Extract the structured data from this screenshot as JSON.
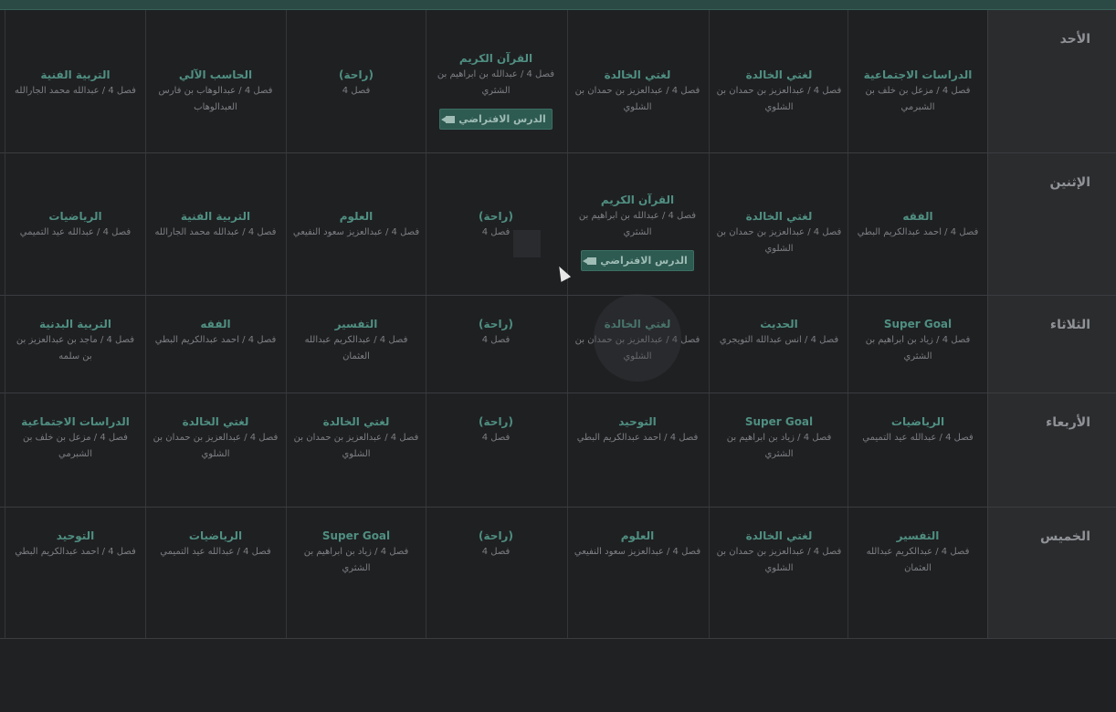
{
  "days": [
    "الأحد",
    "الإثنين",
    "الثلاثاء",
    "الأربعاء",
    "الخميس"
  ],
  "virtual_lesson_label": "الدرس الافتراضي",
  "rows": [
    {
      "cells": [
        {
          "subject": "الدراسات الاجتماعية",
          "teacher": "فصل 4 / مزعل بن خلف بن الشبرمي"
        },
        {
          "subject": "لغتي الخالدة",
          "teacher": "فصل 4 / عبدالعزيز بن حمدان بن الشلوي"
        },
        {
          "subject": "لغتي الخالدة",
          "teacher": "فصل 4 / عبدالعزيز بن حمدان بن الشلوي"
        },
        {
          "subject": "القرآن الكريم",
          "teacher": "فصل 4 / عبدالله بن ابراهيم بن الشثري",
          "virtual": true
        },
        {
          "subject": "(راحة)",
          "teacher": "فصل 4"
        },
        {
          "subject": "الحاسب الآلي",
          "teacher": "فصل 4 / عبدالوهاب بن فارس العبدالوهاب"
        },
        {
          "subject": "التربية الفنية",
          "teacher": "فصل 4 / عبدالله محمد الجارالله"
        }
      ]
    },
    {
      "cells": [
        {
          "subject": "الفقه",
          "teacher": "فصل 4 / احمد عبدالكريم البطي"
        },
        {
          "subject": "لغتي الخالدة",
          "teacher": "فصل 4 / عبدالعزيز بن حمدان بن الشلوي"
        },
        {
          "subject": "القرآن الكريم",
          "teacher": "فصل 4 / عبدالله بن ابراهيم بن الشثري",
          "virtual": true
        },
        {
          "subject": "(راحة)",
          "teacher": "فصل 4"
        },
        {
          "subject": "العلوم",
          "teacher": "فصل 4 / عبدالعزيز سعود النفيعي"
        },
        {
          "subject": "التربية الفنية",
          "teacher": "فصل 4 / عبدالله محمد الجارالله"
        },
        {
          "subject": "الرياضيات",
          "teacher": "فصل 4 / عبدالله عيد التميمي"
        }
      ]
    },
    {
      "cells": [
        {
          "subject": "Super Goal",
          "teacher": "فصل 4 / زياد بن ابراهيم بن الشثري"
        },
        {
          "subject": "الحديث",
          "teacher": "فصل 4 / انس عبدالله التويجري"
        },
        {
          "subject": "لغتي الخالدة",
          "teacher": "فصل 4 / عبدالعزيز بن حمدان بن الشلوي"
        },
        {
          "subject": "(راحة)",
          "teacher": "فصل 4"
        },
        {
          "subject": "التفسير",
          "teacher": "فصل 4 / عبدالكريم عبدالله العثمان"
        },
        {
          "subject": "الفقه",
          "teacher": "فصل 4 / احمد عبدالكريم البطي"
        },
        {
          "subject": "التربية البدنية",
          "teacher": "فصل 4 / ماجد بن عبدالعزيز بن بن سلمه"
        }
      ]
    },
    {
      "cells": [
        {
          "subject": "الرياضيات",
          "teacher": "فصل 4 / عبدالله عيد التميمي"
        },
        {
          "subject": "Super Goal",
          "teacher": "فصل 4 / زياد بن ابراهيم بن الشثري"
        },
        {
          "subject": "التوحيد",
          "teacher": "فصل 4 / احمد عبدالكريم البطي"
        },
        {
          "subject": "(راحة)",
          "teacher": "فصل 4"
        },
        {
          "subject": "لغتي الخالدة",
          "teacher": "فصل 4 / عبدالعزيز بن حمدان بن الشلوي"
        },
        {
          "subject": "لغتي الخالدة",
          "teacher": "فصل 4 / عبدالعزيز بن حمدان بن الشلوي"
        },
        {
          "subject": "الدراسات الاجتماعية",
          "teacher": "فصل 4 / مزعل بن خلف بن الشبرمي"
        }
      ]
    },
    {
      "cells": [
        {
          "subject": "التفسير",
          "teacher": "فصل 4 / عبدالكريم عبدالله العثمان"
        },
        {
          "subject": "لغتي الخالدة",
          "teacher": "فصل 4 / عبدالعزيز بن حمدان بن الشلوي"
        },
        {
          "subject": "العلوم",
          "teacher": "فصل 4 / عبدالعزيز سعود النفيعي"
        },
        {
          "subject": "(راحة)",
          "teacher": "فصل 4"
        },
        {
          "subject": "Super Goal",
          "teacher": "فصل 4 / زياد بن ابراهيم بن الشثري"
        },
        {
          "subject": "الرياضيات",
          "teacher": "فصل 4 / عبدالله عيد التميمي"
        },
        {
          "subject": "التوحيد",
          "teacher": "فصل 4 / احمد عبدالكريم البطي"
        }
      ]
    }
  ]
}
